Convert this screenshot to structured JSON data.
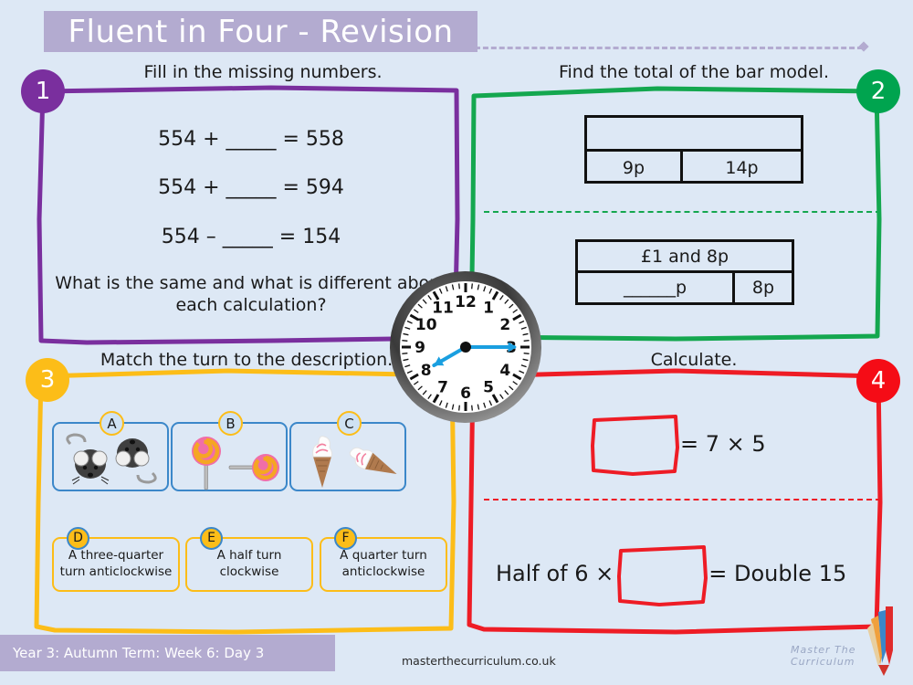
{
  "header": {
    "title": "Fluent in Four - Revision"
  },
  "questions": [
    {
      "number": "1",
      "color": "#7a2f9e",
      "heading": "Fill in the missing numbers.",
      "equations": [
        "554 + _____ = 558",
        "554 + _____ = 594",
        "554 – _____ = 154"
      ],
      "prompt": "What is the same and what is different about each calculation?"
    },
    {
      "number": "2",
      "color": "#00a44f",
      "heading": "Find the total of the bar model.",
      "bar_models": [
        {
          "whole": "",
          "parts": [
            "9p",
            "14p"
          ]
        },
        {
          "whole": "£1 and 8p",
          "parts": [
            "______p",
            "8p"
          ]
        }
      ]
    },
    {
      "number": "3",
      "color": "#fcbd18",
      "heading": "Match the turn to the description.",
      "picture_cards": [
        {
          "label": "A",
          "image": "mice-pair-icon"
        },
        {
          "label": "B",
          "image": "lollipop-pair-icon"
        },
        {
          "label": "C",
          "image": "ice-cream-pair-icon"
        }
      ],
      "description_cards": [
        {
          "label": "D",
          "text": "A three-quarter turn anticlockwise"
        },
        {
          "label": "E",
          "text": "A half turn clockwise"
        },
        {
          "label": "F",
          "text": "A quarter turn anticlockwise"
        }
      ]
    },
    {
      "number": "4",
      "color": "#f50c16",
      "heading": "Calculate.",
      "calculations": [
        {
          "before": "",
          "after": "= 7 × 5"
        },
        {
          "before": "Half of 6  ×",
          "after": "= Double 15"
        }
      ]
    }
  ],
  "clock": {
    "hour_numbers": [
      "12",
      "1",
      "2",
      "3",
      "4",
      "5",
      "6",
      "7",
      "8",
      "9",
      "10",
      "11"
    ],
    "hand_color": "#1a9fe0"
  },
  "footer": {
    "term_label": "Year 3: Autumn Term: Week 6: Day 3",
    "url": "masterthecurriculum.co.uk",
    "logo_text": "Master The Curriculum"
  }
}
